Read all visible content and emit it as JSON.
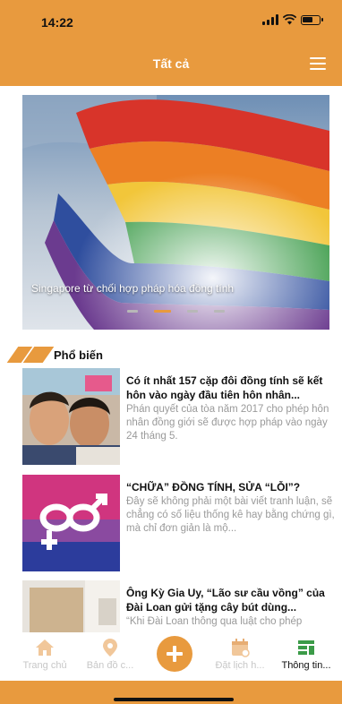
{
  "status_bar": {
    "time": "14:22"
  },
  "header": {
    "title": "Tất cả"
  },
  "banner": {
    "caption": "Singapore từ chối hợp pháp hóa đồng tính",
    "slide_count": 4,
    "active_slide": 2
  },
  "section": {
    "title": "Phổ biến"
  },
  "articles": [
    {
      "title": "Có ít nhất 157 cặp đôi đồng tính sẽ kết hôn vào ngày đầu tiên hôn nhân...",
      "description": "Phán quyết của tòa năm 2017 cho phép hôn nhân đồng giới sẽ được hợp pháp vào ngày 24 tháng 5."
    },
    {
      "title": "“CHỮA” ĐỒNG TÍNH, SỬA “LỖI”?",
      "description": "Đây sẽ không phải một bài viết tranh luận, sẽ chẳng có số liệu thống kê hay bằng chứng gì, mà chỉ đơn giản là mộ..."
    },
    {
      "title": "Ông Kỳ Gia Uy, “Lão sư cầu vồng” của Đài Loan gửi tặng cây bút dùng...",
      "description": "“Khi Đài Loan thông qua luật cho phép"
    }
  ],
  "bottom_nav": {
    "items": [
      {
        "label": "Trang chủ",
        "icon": "home-icon"
      },
      {
        "label": "Bản đồ c...",
        "icon": "map-pin-icon"
      },
      {
        "label": "Đặt lịch h...",
        "icon": "calendar-icon"
      },
      {
        "label": "Thông tin...",
        "icon": "info-icon"
      }
    ],
    "add_icon": "plus-icon"
  },
  "colors": {
    "accent": "#e89a3e",
    "inactive_label": "#c7c7c7",
    "description_text": "#9a9a9a"
  }
}
